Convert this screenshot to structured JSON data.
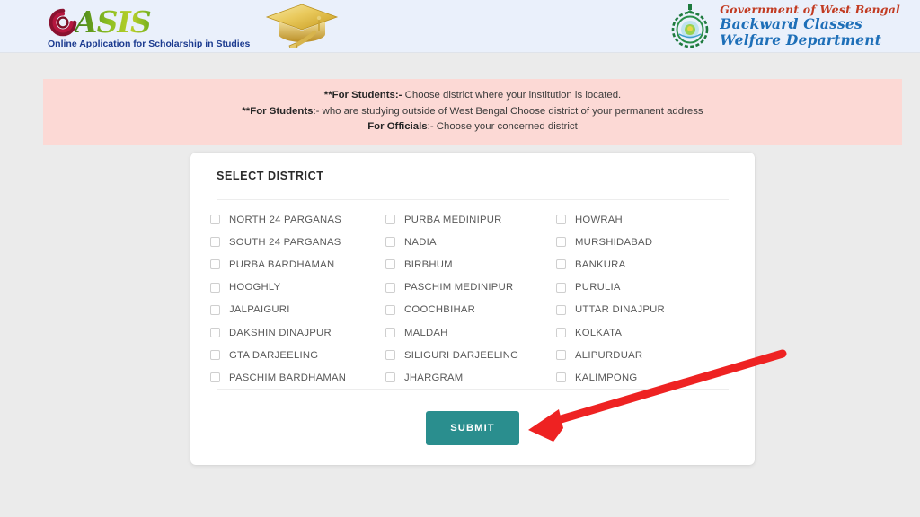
{
  "header": {
    "logo": {
      "brand_letter": "O",
      "brand_rest": "ASIS",
      "tagline": "Online Application for Scholarship in Studies",
      "cap_icon": "graduation-cap-icon"
    },
    "government": {
      "emblem_icon": "west-bengal-government-emblem-icon",
      "line1": "Government of West Bengal",
      "line2": "Backward Classes",
      "line3": "Welfare Department"
    },
    "background_color": "#eaf0fb"
  },
  "notice": {
    "background_color": "#fcd9d5",
    "lines": [
      {
        "prefix": "**For Students:-",
        "text": " Choose district where your institution is located."
      },
      {
        "prefix": "**For Students",
        "text": ":- who are studying outside of West Bengal Choose district of your permanent address"
      },
      {
        "prefix": "For Officials",
        "text": ":- Choose your concerned district"
      }
    ]
  },
  "card": {
    "title": "SELECT DISTRICT",
    "districts": [
      "NORTH 24 PARGANAS",
      "PURBA MEDINIPUR",
      "HOWRAH",
      "SOUTH 24 PARGANAS",
      "NADIA",
      "MURSHIDABAD",
      "PURBA BARDHAMAN",
      "BIRBHUM",
      "BANKURA",
      "HOOGHLY",
      "PASCHIM MEDINIPUR",
      "PURULIA",
      "JALPAIGURI",
      "COOCHBIHAR",
      "UTTAR DINAJPUR",
      "DAKSHIN DINAJPUR",
      "MALDAH",
      "KOLKATA",
      "GTA DARJEELING",
      "SILIGURI DARJEELING",
      "ALIPURDUAR",
      "PASCHIM BARDHAMAN",
      "JHARGRAM",
      "KALIMPONG"
    ],
    "checked": [],
    "submit_label": "SUBMIT",
    "submit_color": "#2a8e8e"
  },
  "annotation": {
    "arrow_color": "#ee2222",
    "arrow_points_to": "submit-button"
  }
}
